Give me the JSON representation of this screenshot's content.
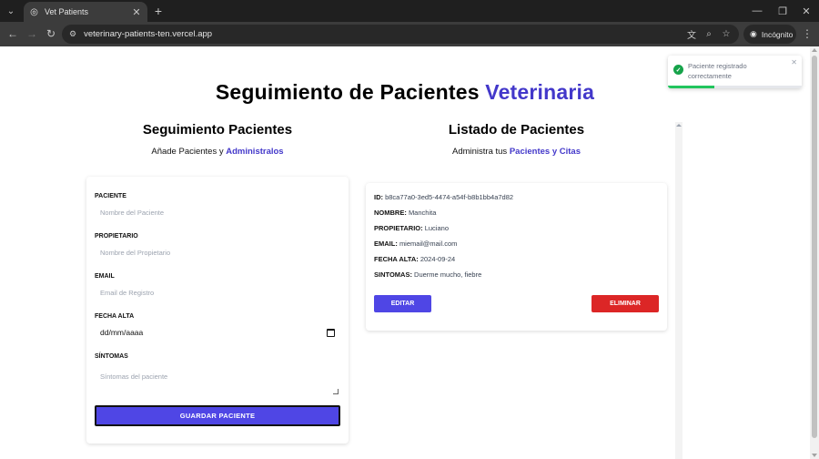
{
  "browser": {
    "tab_title": "Vet Patients",
    "url": "veterinary-patients-ten.vercel.app",
    "incognito_label": "Incógnito"
  },
  "page": {
    "title_main": "Seguimiento de Pacientes",
    "title_accent": "Veterinaria",
    "form_section": {
      "title": "Seguimiento Pacientes",
      "subtitle_prefix": "Añade Pacientes y",
      "subtitle_accent": "Administralos"
    },
    "list_section": {
      "title": "Listado de Pacientes",
      "subtitle_prefix": "Administra tus",
      "subtitle_accent": "Pacientes y Citas"
    },
    "form": {
      "patient_label": "PACIENTE",
      "patient_placeholder": "Nombre del Paciente",
      "owner_label": "PROPIETARIO",
      "owner_placeholder": "Nombre del Propietario",
      "email_label": "EMAIL",
      "email_placeholder": "Email de Registro",
      "date_label": "FECHA ALTA",
      "date_value": "dd/mm/aaaa",
      "symptoms_label": "SÍNTOMAS",
      "symptoms_placeholder": "Síntomas del paciente",
      "submit_label": "GUARDAR PACIENTE"
    },
    "patient": {
      "id_key": "ID:",
      "id_value": "b8ca77a0-3ed5-4474-a54f-b8b1bb4a7d82",
      "name_key": "NOMBRE:",
      "name_value": "Manchita",
      "owner_key": "PROPIETARIO:",
      "owner_value": "Luciano",
      "email_key": "EMAIL:",
      "email_value": "miemail@mail.com",
      "date_key": "FECHA ALTA:",
      "date_value": "2024-09-24",
      "symptoms_key": "SINTOMAS:",
      "symptoms_value": "Duerme mucho, fiebre",
      "edit_label": "EDITAR",
      "delete_label": "ELIMINAR"
    },
    "toast": {
      "message": "Paciente registrado correctamente",
      "progress": 0.35
    }
  },
  "colors": {
    "accent": "#4338ca",
    "primary_button": "#4f46e5",
    "danger_button": "#dc2626",
    "success": "#16a34a"
  }
}
